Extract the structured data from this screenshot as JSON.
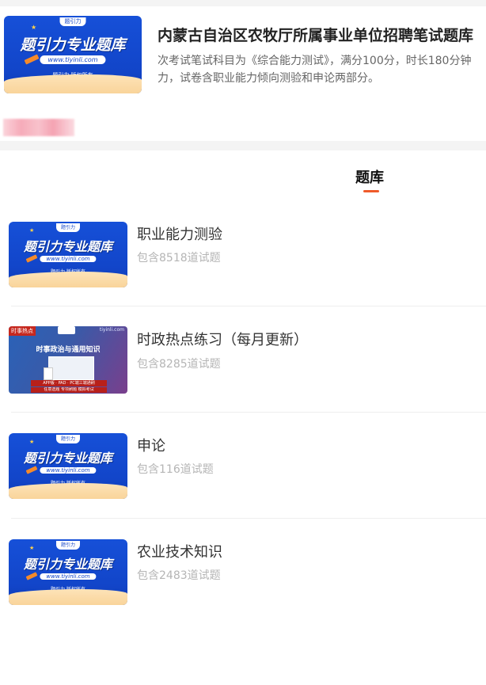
{
  "header": {
    "title": "内蒙古自治区农牧厅所属事业单位招聘笔试题库",
    "description": "次考试笔试科目为《综合能力测试》，满分100分，时长180分钟力，试卷含职业能力倾向测验和申论两部分。",
    "cover": {
      "badge": "题引力",
      "title": "题引力专业题库",
      "url": "www.tiyinli.com",
      "copyright": "题引力 版权所有"
    }
  },
  "tab": {
    "label": "题库"
  },
  "banks": [
    {
      "title": "职业能力测验",
      "count": "包含8518道试题",
      "cover": {
        "badge": "题引力",
        "title": "题引力专业题库",
        "url": "www.tiyinli.com",
        "copyright": "题引力 版权所有"
      }
    },
    {
      "title": "时政热点练习（每月更新）",
      "count": "包含8285道试题",
      "cover": {
        "tag": "时事热点",
        "site": "tiyinli.com",
        "title": "时事政治与通用知识",
        "line1": "APP版 · PAD · PC端三端通刷",
        "line2": "任意选题 专项刷题 模拟考试"
      }
    },
    {
      "title": "申论",
      "count": "包含116道试题",
      "cover": {
        "badge": "题引力",
        "title": "题引力专业题库",
        "url": "www.tiyinli.com",
        "copyright": "题引力 版权所有"
      }
    },
    {
      "title": "农业技术知识",
      "count": "包含2483道试题",
      "cover": {
        "badge": "题引力",
        "title": "题引力专业题库",
        "url": "www.tiyinli.com",
        "copyright": "题引力 版权所有"
      }
    }
  ],
  "colors": {
    "accent": "#ef5a2a",
    "brand_blue": "#1245c9"
  }
}
